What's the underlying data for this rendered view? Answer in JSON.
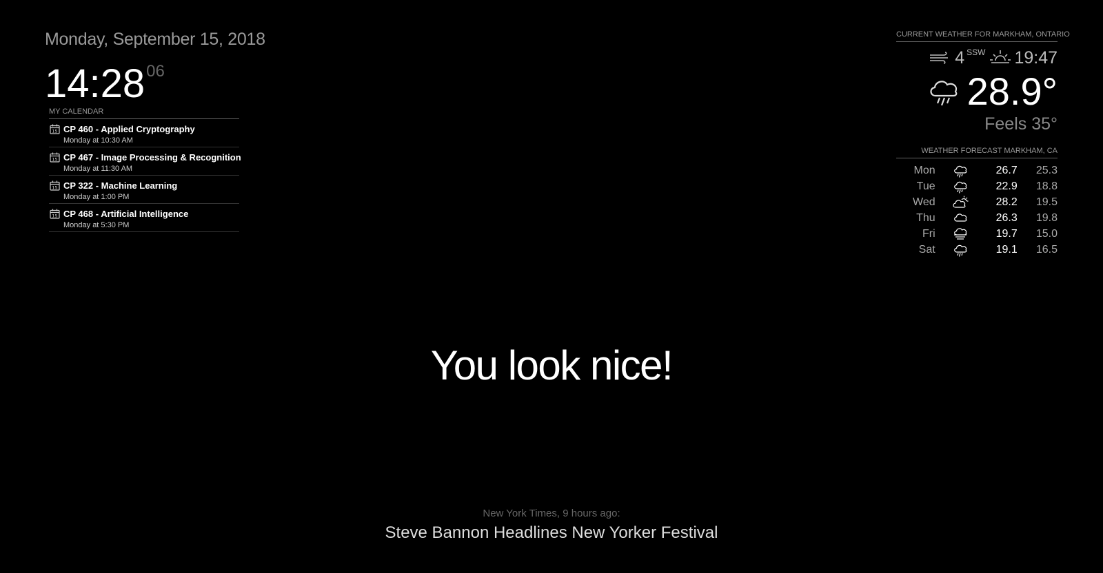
{
  "clock": {
    "date": "Monday, September 15, 2018",
    "time": "14:28",
    "seconds": "06"
  },
  "calendar": {
    "header": "MY CALENDAR",
    "icon": "calendar-icon",
    "events": [
      {
        "title": "CP 460 - Applied Cryptography",
        "time": "Monday at 10:30 AM"
      },
      {
        "title": "CP 467 - Image Processing & Recognition",
        "time": "Monday at 11:30 AM"
      },
      {
        "title": "CP 322 - Machine Learning",
        "time": "Monday at 1:00 PM"
      },
      {
        "title": "CP 468 - Artificial Intelligence",
        "time": "Monday at 5:30 PM"
      }
    ]
  },
  "current_weather": {
    "header": "CURRENT WEATHER FOR MARKHAM, ONTARIO",
    "wind_speed": "4",
    "wind_direction": "SSW",
    "sunset_time": "19:47",
    "temperature": "28.9°",
    "feels_like": "Feels 35°",
    "condition_icon": "rain-icon"
  },
  "forecast": {
    "header": "WEATHER FORECAST MARKHAM, CA",
    "days": [
      {
        "day": "Mon",
        "icon": "rain-icon",
        "max": "26.7",
        "min": "25.3"
      },
      {
        "day": "Tue",
        "icon": "rain-icon",
        "max": "22.9",
        "min": "18.8"
      },
      {
        "day": "Wed",
        "icon": "partly-cloudy-icon",
        "max": "28.2",
        "min": "19.5"
      },
      {
        "day": "Thu",
        "icon": "cloud-icon",
        "max": "26.3",
        "min": "19.8"
      },
      {
        "day": "Fri",
        "icon": "windy-cloud-icon",
        "max": "19.7",
        "min": "15.0"
      },
      {
        "day": "Sat",
        "icon": "rain-icon",
        "max": "19.1",
        "min": "16.5"
      }
    ]
  },
  "compliment": "You look nice!",
  "news": {
    "source": "New York Times, 9 hours ago:",
    "headline": "Steve Bannon Headlines New Yorker Festival"
  }
}
